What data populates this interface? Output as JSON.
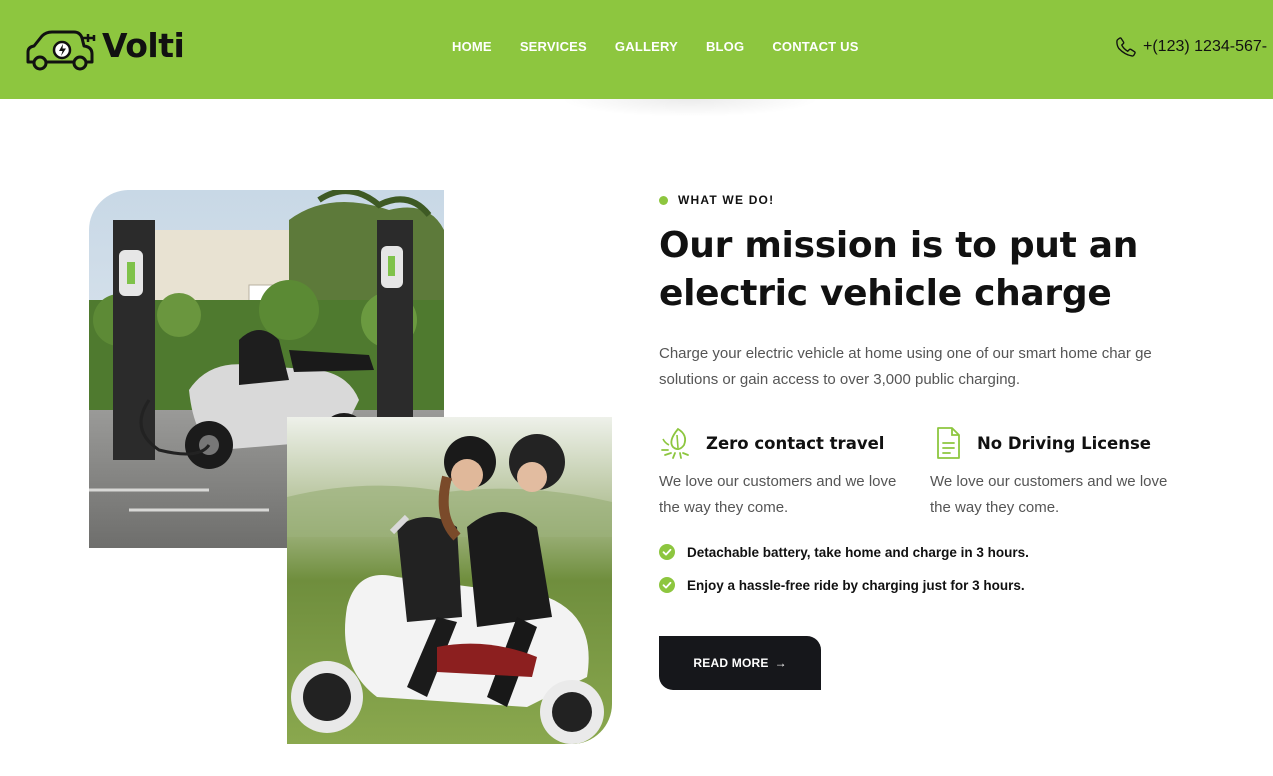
{
  "brand": {
    "name": "Volti",
    "logo_icon": "electric-car-plug-icon"
  },
  "nav": {
    "items": [
      {
        "label": "HOME"
      },
      {
        "label": "SERVICES"
      },
      {
        "label": "GALLERY"
      },
      {
        "label": "BLOG"
      },
      {
        "label": "CONTACT US"
      }
    ]
  },
  "contact": {
    "phone": "+(123) 1234-567-",
    "icon": "phone-icon"
  },
  "section": {
    "eyebrow": "WHAT WE DO!",
    "title_line1": "Our mission is to put an",
    "title_line2": "electric vehicle charge",
    "description": "Charge your electric vehicle at home using one of our smart home char ge solutions or gain access to over 3,000 public charging.",
    "features": [
      {
        "icon": "eco-leaf-icon",
        "title": "Zero contact travel",
        "text": "We love our customers and we love the way they come."
      },
      {
        "icon": "document-icon",
        "title": "No Driving License",
        "text": "We love our customers and we love the way they come."
      }
    ],
    "checklist": [
      {
        "icon": "check-circle-icon",
        "text": "Detachable battery, take home and charge in 3 hours."
      },
      {
        "icon": "check-circle-icon",
        "text": "Enjoy a hassle-free ride by charging just for 3 hours."
      }
    ],
    "cta": {
      "label": "READ MORE",
      "arrow": "→"
    }
  },
  "colors": {
    "accent": "#8dc63f",
    "dark": "#16171b",
    "body_text": "#555555"
  }
}
